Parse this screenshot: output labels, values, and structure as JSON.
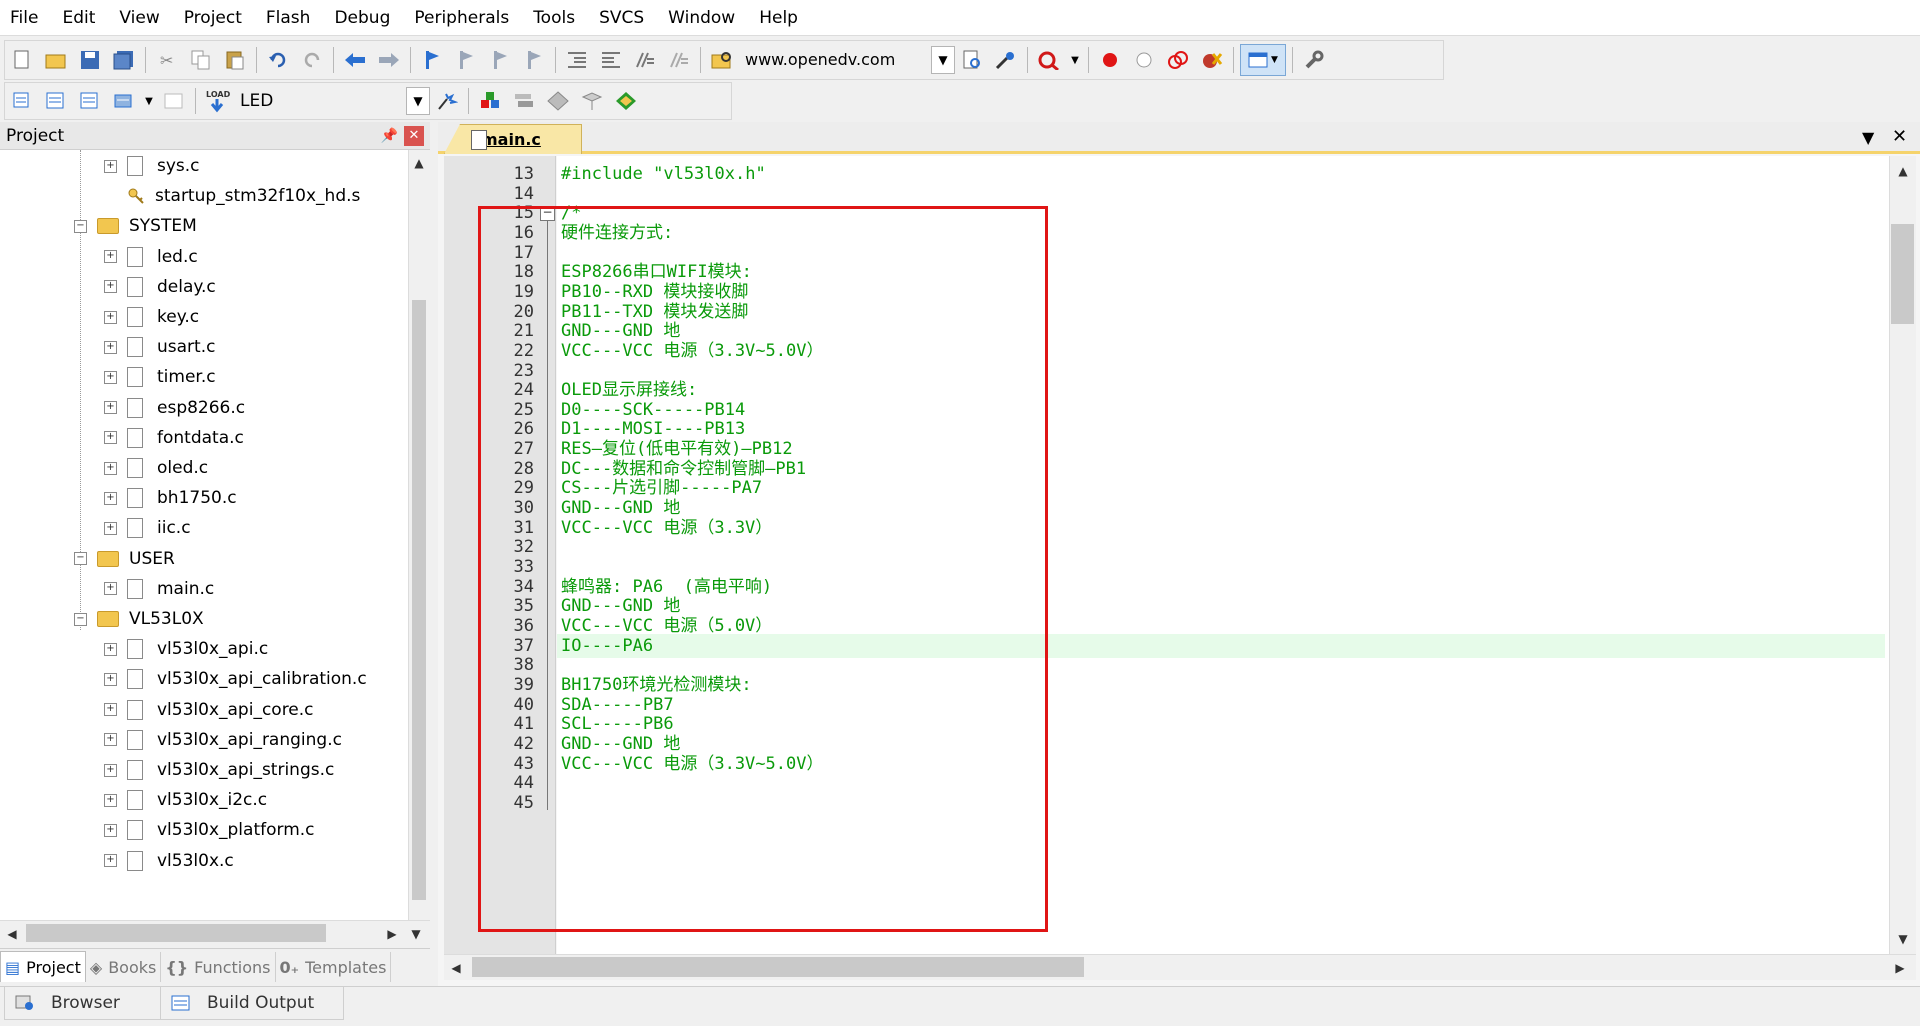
{
  "menu": [
    "File",
    "Edit",
    "View",
    "Project",
    "Flash",
    "Debug",
    "Peripherals",
    "Tools",
    "SVCS",
    "Window",
    "Help"
  ],
  "toolbar": {
    "url": "www.openedv.com",
    "target": "LED",
    "load_label": "LOAD"
  },
  "project_panel": {
    "title": "Project",
    "tree": [
      {
        "label": "sys.c",
        "kind": "file",
        "level": 2
      },
      {
        "label": "startup_stm32f10x_hd.s",
        "kind": "startup",
        "level": 2
      },
      {
        "label": "SYSTEM",
        "kind": "folder",
        "level": 1
      },
      {
        "label": "led.c",
        "kind": "file",
        "level": 2
      },
      {
        "label": "delay.c",
        "kind": "file",
        "level": 2
      },
      {
        "label": "key.c",
        "kind": "file",
        "level": 2
      },
      {
        "label": "usart.c",
        "kind": "file",
        "level": 2
      },
      {
        "label": "timer.c",
        "kind": "file",
        "level": 2
      },
      {
        "label": "esp8266.c",
        "kind": "file",
        "level": 2
      },
      {
        "label": "fontdata.c",
        "kind": "file",
        "level": 2
      },
      {
        "label": "oled.c",
        "kind": "file",
        "level": 2
      },
      {
        "label": "bh1750.c",
        "kind": "file",
        "level": 2
      },
      {
        "label": "iic.c",
        "kind": "file",
        "level": 2
      },
      {
        "label": "USER",
        "kind": "folder",
        "level": 1
      },
      {
        "label": "main.c",
        "kind": "file",
        "level": 2
      },
      {
        "label": "VL53L0X",
        "kind": "folder",
        "level": 1
      },
      {
        "label": "vl53l0x_api.c",
        "kind": "file",
        "level": 2
      },
      {
        "label": "vl53l0x_api_calibration.c",
        "kind": "file",
        "level": 2
      },
      {
        "label": "vl53l0x_api_core.c",
        "kind": "file",
        "level": 2
      },
      {
        "label": "vl53l0x_api_ranging.c",
        "kind": "file",
        "level": 2
      },
      {
        "label": "vl53l0x_api_strings.c",
        "kind": "file",
        "level": 2
      },
      {
        "label": "vl53l0x_i2c.c",
        "kind": "file",
        "level": 2
      },
      {
        "label": "vl53l0x_platform.c",
        "kind": "file",
        "level": 2
      },
      {
        "label": "vl53l0x.c",
        "kind": "file",
        "level": 2
      }
    ],
    "tabs": [
      {
        "label": "Project",
        "icon": "project-icon",
        "active": true
      },
      {
        "label": "Books",
        "icon": "books-icon",
        "active": false
      },
      {
        "label": "Functions",
        "icon": "functions-icon",
        "active": false
      },
      {
        "label": "Templates",
        "icon": "templates-icon",
        "active": false
      }
    ]
  },
  "editor": {
    "tab_label": "main.c",
    "highlight_line": 37,
    "lines": [
      {
        "n": "13",
        "text": "#include \"vl53l0x.h\"",
        "color": "#0a9a0a"
      },
      {
        "n": "14",
        "text": ""
      },
      {
        "n": "15",
        "text": "/*"
      },
      {
        "n": "16",
        "text": "硬件连接方式:"
      },
      {
        "n": "17",
        "text": ""
      },
      {
        "n": "18",
        "text": "ESP8266串口WIFI模块:"
      },
      {
        "n": "19",
        "text": "PB10--RXD 模块接收脚"
      },
      {
        "n": "20",
        "text": "PB11--TXD 模块发送脚"
      },
      {
        "n": "21",
        "text": "GND---GND 地"
      },
      {
        "n": "22",
        "text": "VCC---VCC 电源（3.3V~5.0V）"
      },
      {
        "n": "23",
        "text": ""
      },
      {
        "n": "24",
        "text": "OLED显示屏接线:"
      },
      {
        "n": "25",
        "text": "D0----SCK-----PB14"
      },
      {
        "n": "26",
        "text": "D1----MOSI----PB13"
      },
      {
        "n": "27",
        "text": "RES—复位(低电平有效)—PB12"
      },
      {
        "n": "28",
        "text": "DC---数据和命令控制管脚—PB1"
      },
      {
        "n": "29",
        "text": "CS---片选引脚-----PA7"
      },
      {
        "n": "30",
        "text": "GND---GND 地"
      },
      {
        "n": "31",
        "text": "VCC---VCC 电源（3.3V）"
      },
      {
        "n": "32",
        "text": ""
      },
      {
        "n": "33",
        "text": ""
      },
      {
        "n": "34",
        "text": "蜂鸣器: PA6  (高电平响)"
      },
      {
        "n": "35",
        "text": "GND---GND 地"
      },
      {
        "n": "36",
        "text": "VCC---VCC 电源（5.0V）"
      },
      {
        "n": "37",
        "text": "IO----PA6"
      },
      {
        "n": "38",
        "text": ""
      },
      {
        "n": "39",
        "text": "BH1750环境光检测模块:"
      },
      {
        "n": "40",
        "text": "SDA-----PB7"
      },
      {
        "n": "41",
        "text": "SCL-----PB6"
      },
      {
        "n": "42",
        "text": "GND---GND 地"
      },
      {
        "n": "43",
        "text": "VCC---VCC 电源（3.3V~5.0V）"
      },
      {
        "n": "44",
        "text": ""
      },
      {
        "n": "45",
        "text": ""
      }
    ]
  },
  "bottom_tabs": [
    "Browser",
    "Build Output"
  ],
  "colors": {
    "code_green": "#0a9a0a",
    "highlight": "#e6fbe9",
    "annotation_red": "#e01515",
    "tab_yellow": "#f9e7a6"
  }
}
